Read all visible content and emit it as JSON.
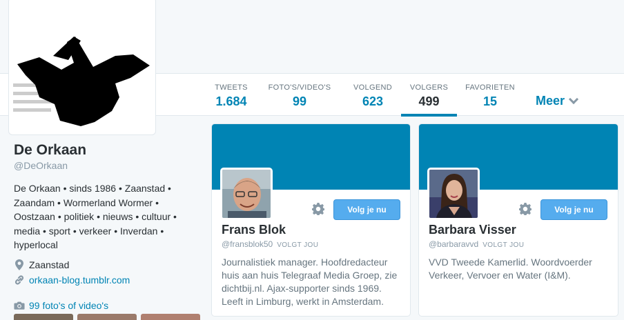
{
  "profile": {
    "name": "De Orkaan",
    "handle": "@DeOrkaan",
    "bio": "De Orkaan • sinds 1986 • Zaanstad • Zaandam • Wormerland Wormer • Oostzaan • politiek • nieuws • cultuur • media • sport • verkeer • Inverdan • hyperlocal",
    "location": "Zaanstad",
    "url": "orkaan-blog.tumblr.com",
    "photos_label": "99 foto's of video's"
  },
  "stats": [
    {
      "label": "TWEETS",
      "value": "1.684"
    },
    {
      "label": "FOTO'S/VIDEO'S",
      "value": "99"
    },
    {
      "label": "VOLGEND",
      "value": "623"
    },
    {
      "label": "VOLGERS",
      "value": "499"
    },
    {
      "label": "FAVORIETEN",
      "value": "15"
    }
  ],
  "more_label": "Meer",
  "cards": [
    {
      "name": "Frans Blok",
      "handle": "@fransblok50",
      "follows_you": "VOLGT JOU",
      "follow_label": "Volg je nu",
      "bio": "Journalistiek manager. Hoofdredacteur huis aan huis Telegraaf Media Groep, zie dichtbij.nl. Ajax-supporter sinds 1969. Leeft in Limburg, werkt in Amsterdam."
    },
    {
      "name": "Barbara Visser",
      "handle": "@barbaravvd",
      "follows_you": "VOLGT JOU",
      "follow_label": "Volg je nu",
      "bio": "VVD Tweede Kamerlid. Woordvoerder Verkeer, Vervoer en Water (I&M)."
    }
  ],
  "colors": {
    "accent": "#0084b4",
    "follow_button": "#55acee",
    "text": "#292f33",
    "muted": "#8899a6"
  },
  "icons": [
    "location-pin-icon",
    "link-icon",
    "camera-icon",
    "gear-icon",
    "chevron-down-icon"
  ]
}
